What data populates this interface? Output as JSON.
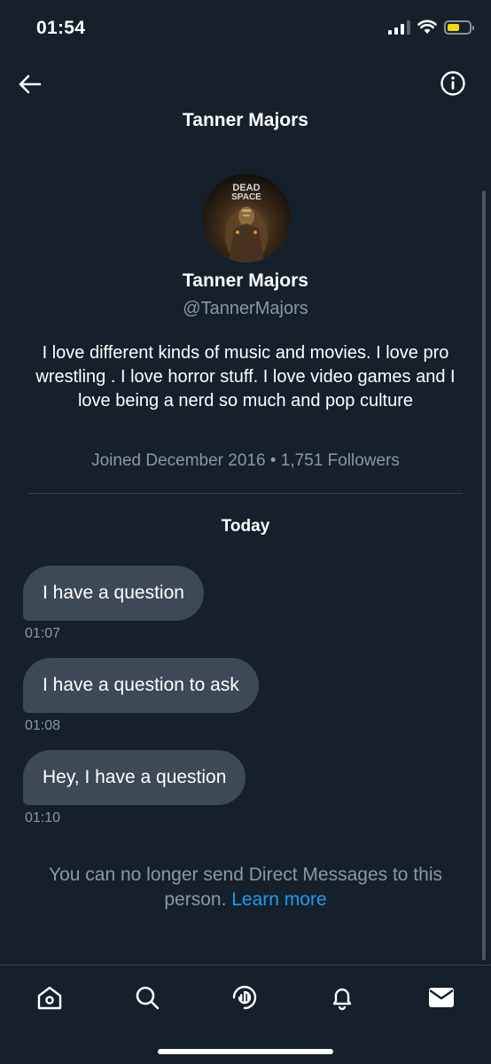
{
  "status_bar": {
    "time": "01:54",
    "battery_color": "#f5d90a"
  },
  "header": {
    "title": "Tanner Majors",
    "back_icon": "arrow-left-icon",
    "info_icon": "info-circle-icon"
  },
  "profile": {
    "avatar_text_line1": "DEAD",
    "avatar_text_line2": "SPACE",
    "name": "Tanner Majors",
    "handle": "@TannerMajors",
    "bio": "I love different kinds of music and movies. I love pro wrestling . I love horror stuff. I love video games and I love being a nerd so much and pop culture",
    "joined": "Joined December 2016",
    "separator": "•",
    "followers": "1,751 Followers"
  },
  "conversation": {
    "day_label": "Today",
    "messages": [
      {
        "text": "I have a question",
        "time": "01:07"
      },
      {
        "text": "I have a question to ask",
        "time": "01:08"
      },
      {
        "text": "Hey, I have a question",
        "time": "01:10"
      }
    ],
    "restriction_text": "You can no longer send Direct Messages to this person.",
    "learn_more": "Learn more"
  },
  "bottom_nav": {
    "items": [
      "home-icon",
      "search-icon",
      "spaces-icon",
      "notifications-icon",
      "messages-icon"
    ],
    "active": "messages-icon"
  },
  "colors": {
    "background": "#15202b",
    "bubble": "#3d4954",
    "secondary_text": "#8b98a5",
    "link": "#1d9bf0"
  }
}
